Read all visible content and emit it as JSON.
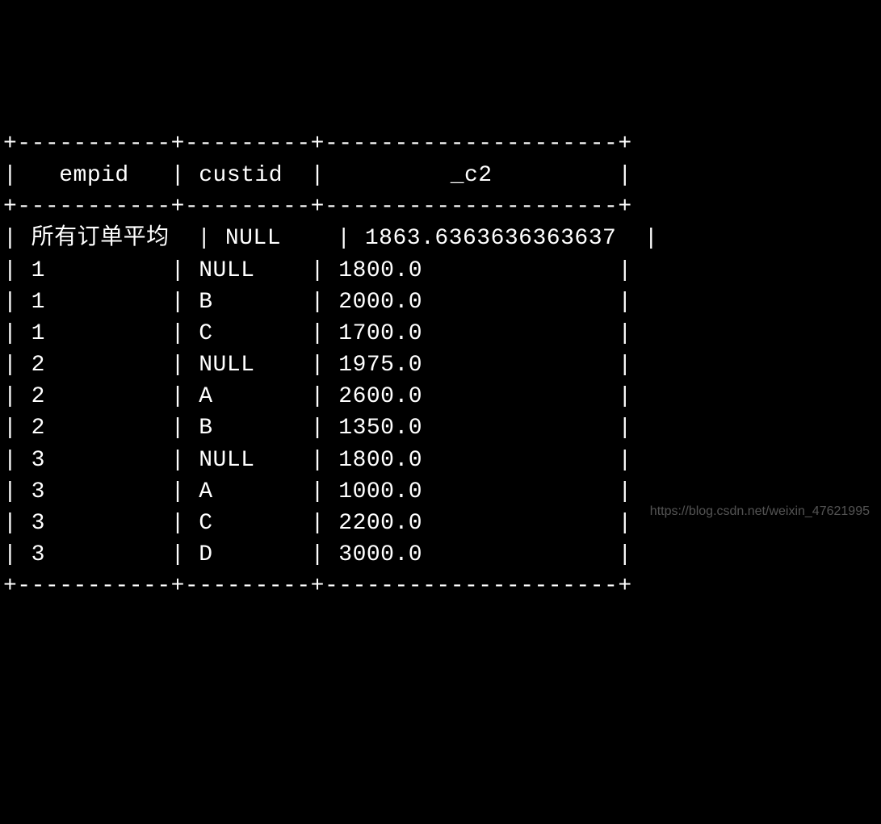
{
  "separator_top": "+-----------+---------+---------------------+",
  "separator_mid": "+-----------+---------+---------------------+",
  "separator_bot": "+-----------+---------+---------------------+",
  "header": {
    "col1": "empid",
    "col2": "custid",
    "col3": "_c2"
  },
  "rows": [
    {
      "empid": "所有订单平均",
      "custid": "NULL",
      "c2": "1863.6363636363637"
    },
    {
      "empid": "1",
      "custid": "NULL",
      "c2": "1800.0"
    },
    {
      "empid": "1",
      "custid": "B",
      "c2": "2000.0"
    },
    {
      "empid": "1",
      "custid": "C",
      "c2": "1700.0"
    },
    {
      "empid": "2",
      "custid": "NULL",
      "c2": "1975.0"
    },
    {
      "empid": "2",
      "custid": "A",
      "c2": "2600.0"
    },
    {
      "empid": "2",
      "custid": "B",
      "c2": "1350.0"
    },
    {
      "empid": "3",
      "custid": "NULL",
      "c2": "1800.0"
    },
    {
      "empid": "3",
      "custid": "A",
      "c2": "1000.0"
    },
    {
      "empid": "3",
      "custid": "C",
      "c2": "2200.0"
    },
    {
      "empid": "3",
      "custid": "D",
      "c2": "3000.0"
    }
  ],
  "header_line": "|   empid   | custid  |         _c2         |",
  "row_lines": [
    "| 所有订单平均  | NULL    | 1863.6363636363637  |",
    "| 1         | NULL    | 1800.0              |",
    "| 1         | B       | 2000.0              |",
    "| 1         | C       | 1700.0              |",
    "| 2         | NULL    | 1975.0              |",
    "| 2         | A       | 2600.0              |",
    "| 2         | B       | 1350.0              |",
    "| 3         | NULL    | 1800.0              |",
    "| 3         | A       | 1000.0              |",
    "| 3         | C       | 2200.0              |",
    "| 3         | D       | 3000.0              |"
  ],
  "watermark": "https://blog.csdn.net/weixin_47621995"
}
